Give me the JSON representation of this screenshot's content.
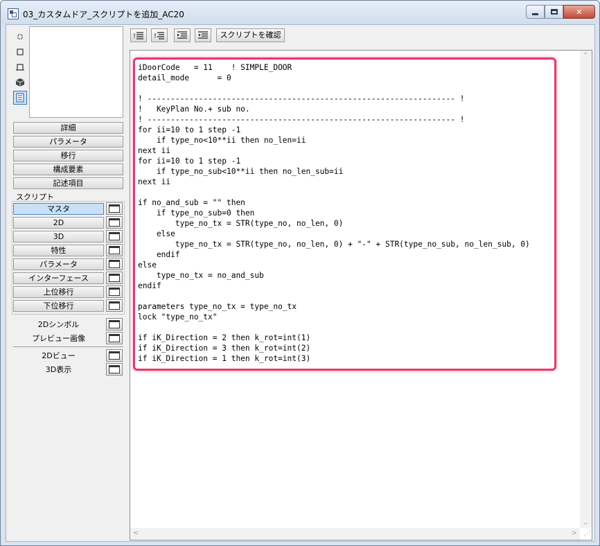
{
  "window": {
    "title": "03_カスタムドア_スクリプトを追加_AC20",
    "minimize": "─",
    "maximize": "□",
    "close": "✕"
  },
  "mode_icons": [
    "info-icon",
    "2d-icon",
    "plan-icon",
    "3d-cube-icon",
    "list-icon"
  ],
  "side_menu": [
    "詳細",
    "パラメータ",
    "移行",
    "構成要素",
    "記述項目"
  ],
  "script_section": {
    "label": "スクリプト",
    "items": [
      "マスタ",
      "2D",
      "3D",
      "特性",
      "パラメータ",
      "インターフェース",
      "上位移行",
      "下位移行"
    ],
    "selected": "マスタ"
  },
  "extra_items": [
    "2Dシンボル",
    "プレビュー画像"
  ],
  "view_items": [
    "2Dビュー",
    "3D表示"
  ],
  "toolbar": {
    "check_script": "スクリプトを確認"
  },
  "code_lines": [
    "iDoorCode   = 11    ! SIMPLE_DOOR",
    "detail_mode      = 0",
    "",
    "! ------------------------------------------------------------------ !",
    "!   KeyPlan No.+ sub no.",
    "! ------------------------------------------------------------------ !",
    "for ii=10 to 1 step -1",
    "    if type_no<10**ii then no_len=ii",
    "next ii",
    "for ii=10 to 1 step -1",
    "    if type_no_sub<10**ii then no_len_sub=ii",
    "next ii",
    "",
    "if no_and_sub = \"\" then",
    "    if type_no_sub=0 then",
    "        type_no_tx = STR(type_no, no_len, 0)",
    "    else",
    "        type_no_tx = STR(type_no, no_len, 0) + \"-\" + STR(type_no_sub, no_len_sub, 0)",
    "    endif",
    "else",
    "    type_no_tx = no_and_sub",
    "endif",
    "",
    "parameters type_no_tx = type_no_tx",
    "lock \"type_no_tx\"",
    "",
    "if iK_Direction = 2 then k_rot=int(1)",
    "if iK_Direction = 3 then k_rot=int(2)",
    "if iK_Direction = 1 then k_rot=int(3)"
  ],
  "colors": {
    "highlight": "#e8386a",
    "selected": "#c9e0f7"
  }
}
